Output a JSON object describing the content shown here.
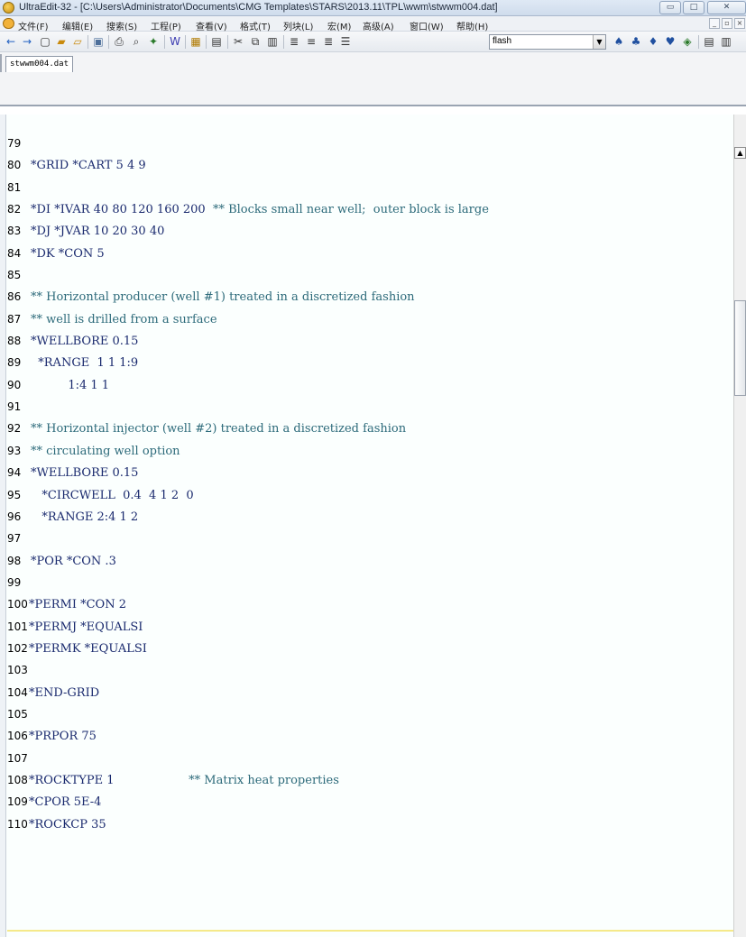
{
  "window": {
    "title": "UltraEdit-32 - [C:\\Users\\Administrator\\Documents\\CMG Templates\\STARS\\2013.11\\TPL\\wwm\\stwwm004.dat]",
    "controls": {
      "minimize": "▭",
      "maximize": "□",
      "close": "✕"
    }
  },
  "menu": {
    "items": [
      "文件(F)",
      "编辑(E)",
      "搜索(S)",
      "工程(P)",
      "查看(V)",
      "格式(T)",
      "列块(L)",
      "宏(M)",
      "高级(A)",
      "窗口(W)",
      "帮助(H)"
    ],
    "mdi": {
      "minimize": "_",
      "restore": "▫",
      "close": "×"
    }
  },
  "toolbar": {
    "icons": [
      "back-arrow-icon",
      "forward-arrow-icon",
      "new-file-icon",
      "open-folder-icon",
      "open-file-icon",
      "save-icon",
      "print-icon",
      "print-preview-icon",
      "spell-icon",
      "word-wrap-icon",
      "hex-icon",
      "column-icon",
      "cut-icon",
      "copy-icon",
      "paste-icon",
      "align-left-icon",
      "align-center-icon",
      "align-right-icon",
      "justify-icon",
      "find-icon",
      "find-next-icon",
      "find-prev-icon",
      "replace-icon",
      "goto-icon",
      "list-icon",
      "columns-icon"
    ],
    "glyphs": {
      "back": "←",
      "forward": "→",
      "new": "▢",
      "open": "📂",
      "save": "▣",
      "print": "⎙",
      "cut": "✂",
      "copy": "⧉",
      "paste": "📋"
    },
    "search_combo_value": "flash"
  },
  "tab": {
    "label": "stwwm004.dat"
  },
  "editor": {
    "lines": [
      {
        "num": "79",
        "text": "",
        "comment": false
      },
      {
        "num": "80",
        "text": "*GRID *CART 5 4 9",
        "comment": false
      },
      {
        "num": "81",
        "text": "",
        "comment": false
      },
      {
        "num": "82",
        "text": "*DI *IVAR 40 80 120 160 200",
        "tail": "  ** Blocks small near well;  outer block is large",
        "comment": false
      },
      {
        "num": "83",
        "text": "*DJ *JVAR 10 20 30 40",
        "comment": false
      },
      {
        "num": "84",
        "text": "*DK *CON 5",
        "comment": false
      },
      {
        "num": "85",
        "text": "",
        "comment": false
      },
      {
        "num": "86",
        "text": "** Horizontal producer (well #1) treated in a discretized fashion",
        "comment": true
      },
      {
        "num": "87",
        "text": "** well is drilled from a surface",
        "comment": true
      },
      {
        "num": "88",
        "text": "*WELLBORE 0.15",
        "comment": false
      },
      {
        "num": "89",
        "text": "  *RANGE  1 1 1:9",
        "comment": false
      },
      {
        "num": "90",
        "text": "          1:4 1 1",
        "comment": false
      },
      {
        "num": "91",
        "text": "",
        "comment": false
      },
      {
        "num": "92",
        "text": "** Horizontal injector (well #2) treated in a discretized fashion",
        "comment": true
      },
      {
        "num": "93",
        "text": "** circulating well option",
        "comment": true
      },
      {
        "num": "94",
        "text": "*WELLBORE 0.15",
        "comment": false
      },
      {
        "num": "95",
        "text": "   *CIRCWELL  0.4  4 1 2  0",
        "comment": false
      },
      {
        "num": "96",
        "text": "   *RANGE 2:4 1 2",
        "comment": false
      },
      {
        "num": "97",
        "text": "",
        "comment": false
      },
      {
        "num": "98",
        "text": "*POR *CON .3",
        "comment": false
      },
      {
        "num": "99",
        "text": "",
        "comment": false
      },
      {
        "num": "100",
        "text": "*PERMI *CON 2",
        "comment": false
      },
      {
        "num": "101",
        "text": "*PERMJ *EQUALSI",
        "comment": false
      },
      {
        "num": "102",
        "text": "*PERMK *EQUALSI",
        "comment": false
      },
      {
        "num": "103",
        "text": "",
        "comment": false
      },
      {
        "num": "104",
        "text": "*END-GRID",
        "comment": false
      },
      {
        "num": "105",
        "text": "",
        "comment": false
      },
      {
        "num": "106",
        "text": "*PRPOR 75",
        "comment": false
      },
      {
        "num": "107",
        "text": "",
        "comment": false
      },
      {
        "num": "108",
        "text": "*ROCKTYPE 1",
        "tail": "                    ** Matrix heat properties",
        "comment": false
      },
      {
        "num": "109",
        "text": "*CPOR 5E-4",
        "comment": false
      },
      {
        "num": "110",
        "text": "*ROCKCP 35",
        "comment": false
      }
    ]
  },
  "scrollbar": {
    "up_arrow": "▲"
  }
}
